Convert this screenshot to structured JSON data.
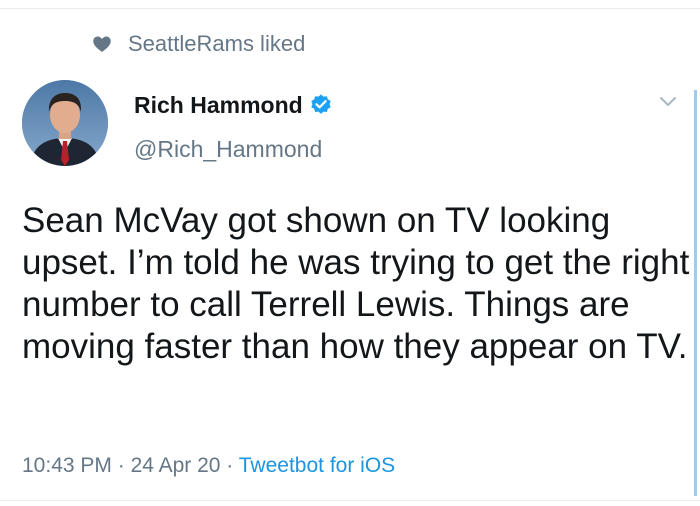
{
  "social_context": {
    "icon": "heart-icon",
    "text": "SeattleRams liked"
  },
  "author": {
    "display_name": "Rich Hammond",
    "handle": "@Rich_Hammond",
    "verified": true,
    "avatar": "avatar"
  },
  "tweet": {
    "text": "Sean McVay got shown on TV looking upset. I’m told he was trying to get the right number to call Terrell Lewis. Things are moving faster than how they appear on TV.",
    "time": "10:43 PM",
    "separator1": " · ",
    "date": "24 Apr 20",
    "separator2": " · ",
    "source": "Tweetbot for iOS"
  },
  "colors": {
    "link": "#1b95e0",
    "muted": "#657786",
    "text": "#14171a",
    "verified": "#1da1f2"
  }
}
